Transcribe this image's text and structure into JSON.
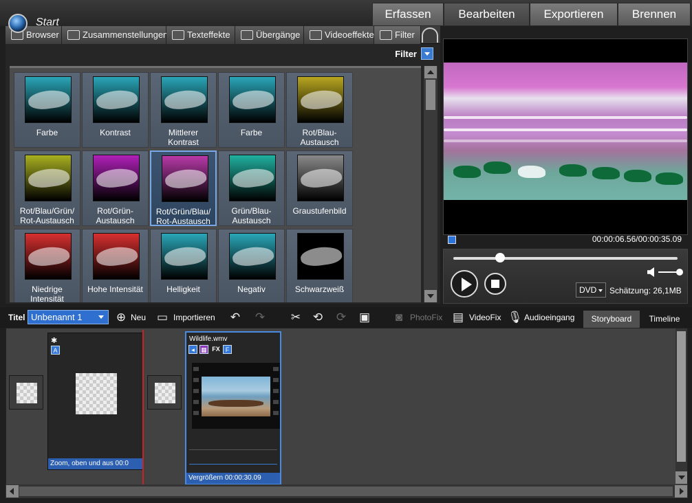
{
  "header": {
    "start_label": "Start",
    "main_tabs": [
      "Erfassen",
      "Bearbeiten",
      "Exportieren",
      "Brennen"
    ],
    "active_tab": "Bearbeiten"
  },
  "subtabs": [
    "Browser",
    "Zusammenstellungen",
    "Texteffekte",
    "Übergänge",
    "Videoeffekte",
    "Filter"
  ],
  "filter_bar": {
    "label": "Filter"
  },
  "effects": [
    {
      "label": "Farbe",
      "tint": "#2aa6b8"
    },
    {
      "label": "Kontrast",
      "tint": "#2aa6b8"
    },
    {
      "label": "Mittlerer Kontrast",
      "tint": "#2aa6b8"
    },
    {
      "label": "Farbe",
      "tint": "#2aa6b8"
    },
    {
      "label": "Rot/Blau-Austausch",
      "tint": "#b8a620"
    },
    {
      "label": "Rot/Blau/Grün/ Rot-Austausch",
      "tint": "#a8b020"
    },
    {
      "label": "Rot/Grün-Austausch",
      "tint": "#b020b8"
    },
    {
      "label": "Rot/Grün/Blau/ Rot-Austausch",
      "tint": "#b83aa8"
    },
    {
      "label": "Grün/Blau-Austausch",
      "tint": "#20b0a0"
    },
    {
      "label": "Graustufenbild",
      "tint": "#8a8a8a"
    },
    {
      "label": "Niedrige Intensität",
      "tint": "#d83030"
    },
    {
      "label": "Hohe Intensität",
      "tint": "#d83030"
    },
    {
      "label": "Helligkeit",
      "tint": "#2aa6b8"
    },
    {
      "label": "Negativ",
      "tint": "#2aa6b8"
    },
    {
      "label": "Schwarzweiß",
      "tint": "#000000"
    }
  ],
  "preview": {
    "timecode": "00:00:06.56/00:00:35.09",
    "format": "DVD",
    "estimate": "Schätzung: 26,1MB",
    "progress": 0.21
  },
  "toolbar": {
    "title_label": "Titel",
    "title_value": "Unbenannt 1",
    "new_label": "Neu",
    "import_label": "Importieren",
    "photofix_label": "PhotoFix",
    "videofix_label": "VideoFix",
    "audio_label": "Audioeingang",
    "view_tabs": [
      "Storyboard",
      "Timeline"
    ],
    "active_view": "Storyboard"
  },
  "storyboard": {
    "clip1": {
      "caption": "Zoom, oben und aus",
      "duration": "00:0"
    },
    "clip2": {
      "name": "Wildlife.wmv",
      "caption": "Vergrößern",
      "duration": "00:00:30.09",
      "badges": [
        "FX",
        "F"
      ]
    }
  },
  "colors": {
    "accent": "#3a7ad0",
    "selection": "#79a8e8"
  }
}
